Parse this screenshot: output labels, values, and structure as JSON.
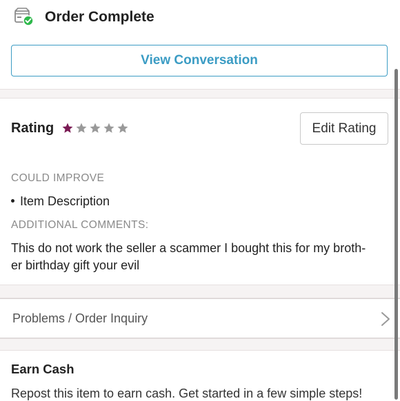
{
  "header": {
    "title": "Order Complete",
    "icon": "package-check-icon",
    "check_color": "#2eb84b"
  },
  "actions": {
    "view_conversation": "View Conversation"
  },
  "rating": {
    "label": "Rating",
    "stars_filled": 1,
    "stars_total": 5,
    "filled_color": "#7a1b54",
    "empty_color": "#999999",
    "edit_button": "Edit Rating"
  },
  "feedback": {
    "could_improve_label": "COULD IMPROVE",
    "could_improve_items": [
      "Item Description"
    ],
    "additional_comments_label": "ADDITIONAL COMMENTS:",
    "comment_line1": "This do not work the seller a scammer I bought this for my broth-",
    "comment_line2": "er birthday gift your evil"
  },
  "inquiry": {
    "label": "Problems / Order Inquiry"
  },
  "earn_cash": {
    "title": "Earn Cash",
    "description": "Repost this item to earn cash. Get started in a few simple steps!"
  },
  "colors": {
    "accent": "#3b9cc4"
  }
}
